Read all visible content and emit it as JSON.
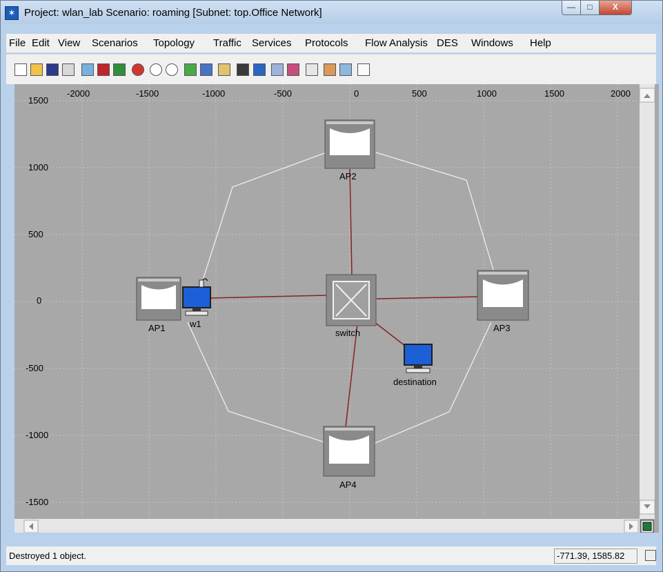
{
  "window": {
    "title": "Project: wlan_lab Scenario: roaming  [Subnet: top.Office Network]",
    "minimize_glyph": "—",
    "maximize_glyph": "□",
    "close_glyph": "X"
  },
  "menu": [
    "File",
    "Edit",
    "View",
    "Scenarios",
    "Topology",
    "Traffic",
    "Services",
    "Protocols",
    "Flow Analysis",
    "DES",
    "Windows",
    "Help"
  ],
  "toolbar_icons": [
    "new-project-icon",
    "open-icon",
    "save-icon",
    "print-icon",
    "rapid-config-icon",
    "fail-node-icon",
    "recover-node-icon",
    "verify-links-icon",
    "zoom-in-icon",
    "zoom-out-icon",
    "import-ace-icon",
    "import-vne-icon",
    "configure-des-icon",
    "run-simulation-icon",
    "view-results-icon",
    "hide-graphs-icon",
    "show-graphs-icon",
    "annotation-icon",
    "navigator-icon",
    "background-icon",
    "properties-icon"
  ],
  "workspace": {
    "x_ticks": [
      "-2000",
      "-1500",
      "-1000",
      "-500",
      "0",
      "500",
      "1000",
      "1500",
      "2000"
    ],
    "y_ticks": [
      "1500",
      "1000",
      "500",
      "0",
      "-500",
      "-1000",
      "-1500"
    ],
    "background": "#a8a8a8",
    "grid_color": "#c4c4c4",
    "wireless_line_color": "#eeeeee",
    "link_color": "#8a1f1f"
  },
  "nodes": {
    "ap2": "AP2",
    "ap1": "AP1",
    "ap3": "AP3",
    "ap4": "AP4",
    "switch": "switch",
    "w1": "w1",
    "destination": "destination"
  },
  "statusbar": {
    "message": "Destroyed 1 object.",
    "coords": "-771.39, 1585.82"
  }
}
